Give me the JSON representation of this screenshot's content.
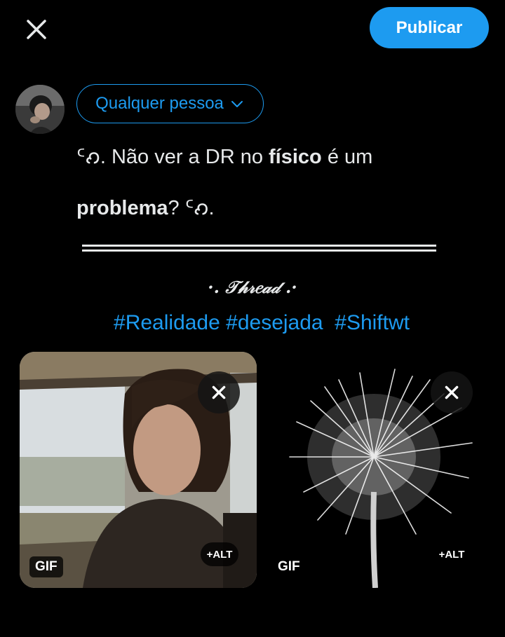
{
  "header": {
    "close_icon": "close-icon",
    "publish_label": "Publicar",
    "accent_color": "#1d9bf0"
  },
  "composer": {
    "audience_label": "Qualquer pessoa",
    "text_line1_prefix": "ᑦ𐑺. Não ver a DR no ",
    "text_line1_bold": "físico",
    "text_line1_suffix": " é um",
    "text_line2_bold": "problema",
    "text_line2_suffix": "? ᑦ𐑺.",
    "thread_label": "·. 𝒯𝒽𝓇𝑒𝒶𝒹 .·",
    "hashtags": "#Realidade #desejada  #Shiftwt"
  },
  "media": [
    {
      "badge": "GIF",
      "alt": "+ALT",
      "remove_icon": "close-icon"
    },
    {
      "badge": "GIF",
      "alt": "+ALT",
      "remove_icon": "close-icon"
    }
  ]
}
